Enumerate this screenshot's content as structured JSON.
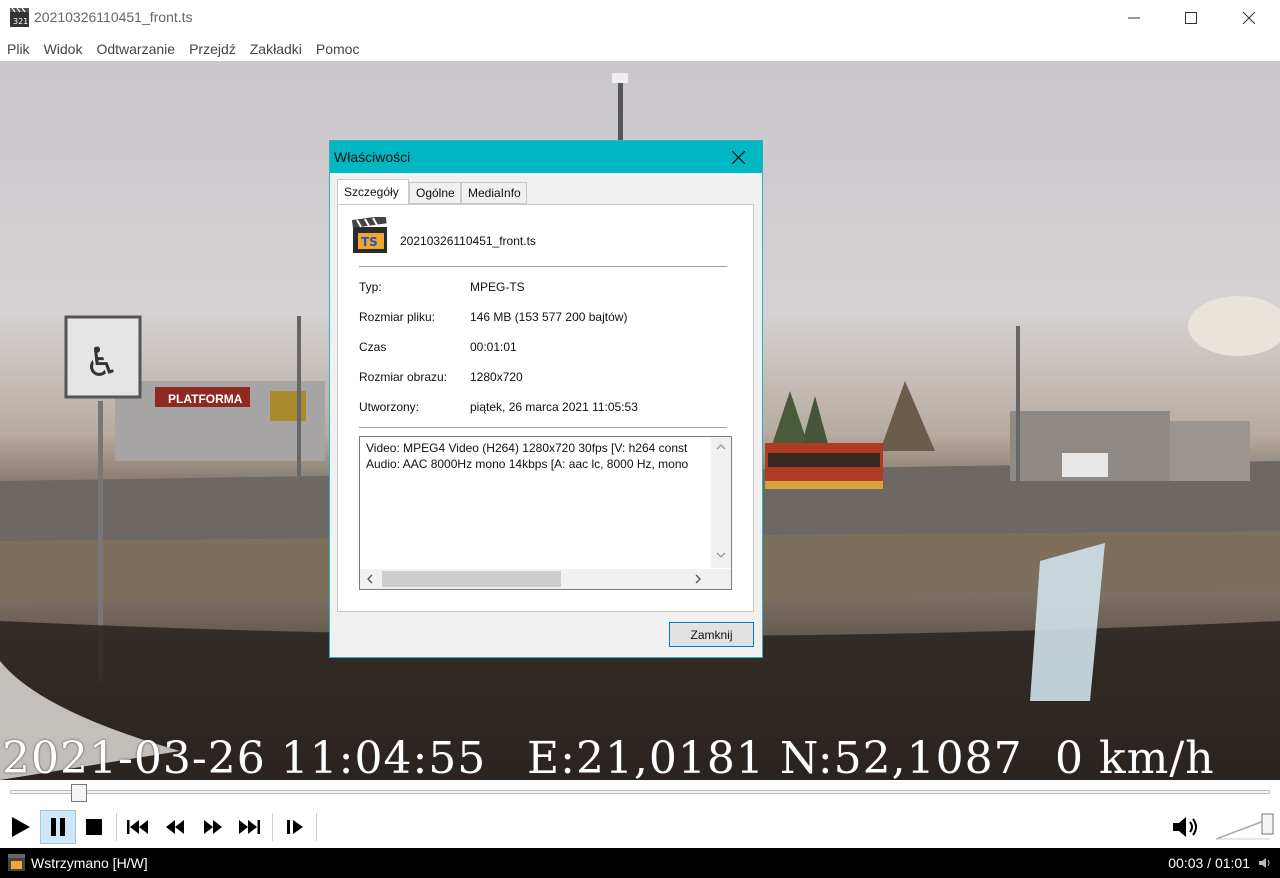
{
  "window": {
    "title": "20210326110451_front.ts"
  },
  "menu": [
    "Plik",
    "Widok",
    "Odtwarzanie",
    "Przejdź",
    "Zakładki",
    "Pomoc"
  ],
  "video": {
    "osd_date": "2021-03-26 11:04:55",
    "osd_coords": "E:21,0181 N:52,1087",
    "osd_speed": "0 km/h",
    "signage_text": "PLATFORMA"
  },
  "dialog": {
    "title": "Właściwości",
    "tabs": [
      "Szczegóły",
      "Ogólne",
      "MediaInfo"
    ],
    "file_icon_text": "TS",
    "file_name": "20210326110451_front.ts",
    "properties": [
      {
        "label": "Typ:",
        "value": "MPEG-TS"
      },
      {
        "label": "Rozmiar pliku:",
        "value": "146 MB (153 577 200 bajtów)"
      },
      {
        "label": "Czas",
        "value": "00:01:01"
      },
      {
        "label": "Rozmiar obrazu:",
        "value": "1280x720"
      },
      {
        "label": "Utworzony:",
        "value": "piątek, 26 marca 2021 11:05:53"
      }
    ],
    "mediainfo": [
      "Video: MPEG4 Video (H264) 1280x720 30fps [V: h264 const",
      "Audio: AAC 8000Hz mono 14kbps [A: aac lc, 8000 Hz, mono"
    ],
    "close_label": "Zamknij"
  },
  "status": {
    "text": "Wstrzymano [H/W]",
    "time": "00:03 / 01:01"
  },
  "colors": {
    "dialog_title": "#00b7c3",
    "accent": "#0078d7"
  }
}
